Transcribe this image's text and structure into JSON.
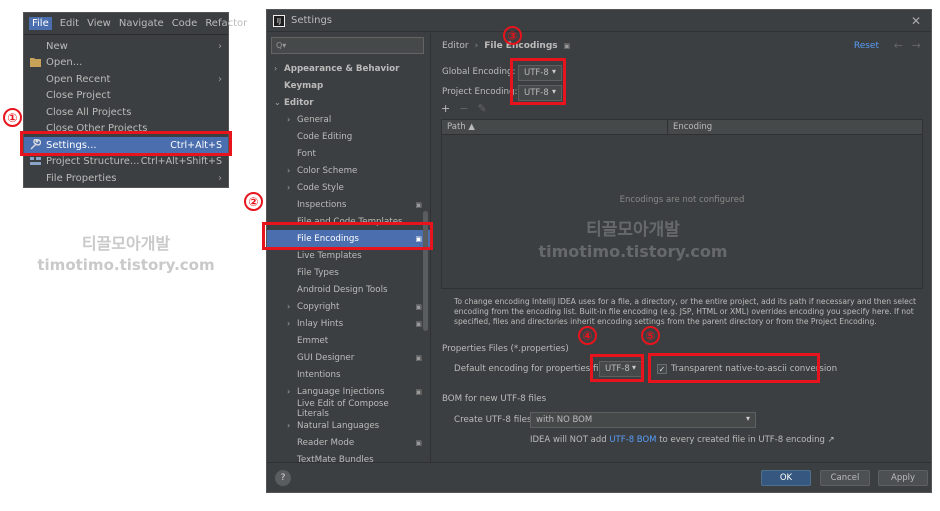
{
  "file_menu": {
    "menubar": [
      "File",
      "Edit",
      "View",
      "Navigate",
      "Code",
      "Refactor"
    ],
    "items": [
      {
        "label": "New",
        "shortcut": "",
        "arrow": "›",
        "icon": ""
      },
      {
        "label": "Open...",
        "shortcut": "",
        "arrow": "",
        "icon": "folder-icon"
      },
      {
        "label": "Open Recent",
        "shortcut": "",
        "arrow": "›",
        "icon": ""
      },
      {
        "label": "Close Project",
        "shortcut": "",
        "arrow": "",
        "icon": ""
      },
      {
        "label": "Close All Projects",
        "shortcut": "",
        "arrow": "",
        "icon": ""
      },
      {
        "label": "Close Other Projects",
        "shortcut": "",
        "arrow": "",
        "icon": ""
      },
      {
        "label": "Settings...",
        "shortcut": "Ctrl+Alt+S",
        "arrow": "",
        "icon": "wrench-icon"
      },
      {
        "label": "Project Structure...",
        "shortcut": "Ctrl+Alt+Shift+S",
        "arrow": "",
        "icon": "structure-icon"
      },
      {
        "label": "File Properties",
        "shortcut": "",
        "arrow": "›",
        "icon": ""
      }
    ]
  },
  "annotations": {
    "n1": "①",
    "n2": "②",
    "n3": "③",
    "n4": "④",
    "n5": "⑤"
  },
  "watermark": {
    "line1": "티끌모아개발",
    "line2": "timotimo.tistory.com"
  },
  "settings": {
    "title": "Settings",
    "close": "✕",
    "search_placeholder": "Q▾",
    "tree": [
      {
        "label": "Appearance & Behavior",
        "arrow": "›",
        "bold": true,
        "badge": "",
        "indent": 0
      },
      {
        "label": "Keymap",
        "arrow": "",
        "bold": true,
        "badge": "",
        "indent": 0
      },
      {
        "label": "Editor",
        "arrow": "⌄",
        "bold": true,
        "badge": "",
        "indent": 0
      },
      {
        "label": "General",
        "arrow": "›",
        "bold": false,
        "badge": "",
        "indent": 1
      },
      {
        "label": "Code Editing",
        "arrow": "",
        "bold": false,
        "badge": "",
        "indent": 1
      },
      {
        "label": "Font",
        "arrow": "",
        "bold": false,
        "badge": "",
        "indent": 1
      },
      {
        "label": "Color Scheme",
        "arrow": "›",
        "bold": false,
        "badge": "",
        "indent": 1
      },
      {
        "label": "Code Style",
        "arrow": "›",
        "bold": false,
        "badge": "",
        "indent": 1
      },
      {
        "label": "Inspections",
        "arrow": "",
        "bold": false,
        "badge": "▣",
        "indent": 1
      },
      {
        "label": "File and Code Templates",
        "arrow": "",
        "bold": false,
        "badge": "",
        "indent": 1
      },
      {
        "label": "File Encodings",
        "arrow": "",
        "bold": false,
        "badge": "▣",
        "indent": 1,
        "selected": true
      },
      {
        "label": "Live Templates",
        "arrow": "",
        "bold": false,
        "badge": "",
        "indent": 1
      },
      {
        "label": "File Types",
        "arrow": "",
        "bold": false,
        "badge": "",
        "indent": 1
      },
      {
        "label": "Android Design Tools",
        "arrow": "",
        "bold": false,
        "badge": "",
        "indent": 1
      },
      {
        "label": "Copyright",
        "arrow": "›",
        "bold": false,
        "badge": "▣",
        "indent": 1
      },
      {
        "label": "Inlay Hints",
        "arrow": "›",
        "bold": false,
        "badge": "▣",
        "indent": 1
      },
      {
        "label": "Emmet",
        "arrow": "",
        "bold": false,
        "badge": "",
        "indent": 1
      },
      {
        "label": "GUI Designer",
        "arrow": "",
        "bold": false,
        "badge": "▣",
        "indent": 1
      },
      {
        "label": "Intentions",
        "arrow": "",
        "bold": false,
        "badge": "",
        "indent": 1
      },
      {
        "label": "Language Injections",
        "arrow": "›",
        "bold": false,
        "badge": "▣",
        "indent": 1
      },
      {
        "label": "Live Edit of Compose Literals",
        "arrow": "",
        "bold": false,
        "badge": "",
        "indent": 1
      },
      {
        "label": "Natural Languages",
        "arrow": "›",
        "bold": false,
        "badge": "",
        "indent": 1
      },
      {
        "label": "Reader Mode",
        "arrow": "",
        "bold": false,
        "badge": "▣",
        "indent": 1
      },
      {
        "label": "TextMate Bundles",
        "arrow": "",
        "bold": false,
        "badge": "",
        "indent": 1
      }
    ],
    "breadcrumb": {
      "part1": "Editor",
      "sep": "›",
      "part2": "File Encodings",
      "pin": "▣"
    },
    "reset": "Reset",
    "back": "←",
    "forward": "→",
    "global_label": "Global Encoding:",
    "global_value": "UTF-8",
    "project_label": "Project Encoding:",
    "project_value": "UTF-8",
    "tool_add": "+",
    "tool_remove": "−",
    "tool_edit": "✎",
    "col_path": "Path ▲",
    "col_encoding": "Encoding",
    "empty_text": "Encodings are not configured",
    "description": "To change encoding IntelliJ IDEA uses for a file, a directory, or the entire project, add its path if necessary and then select encoding from the encoding list. Built-in file encoding (e.g. JSP, HTML or XML) overrides encoding you specify here. If not specified, files and directories inherit encoding settings from the parent directory or from the Project Encoding.",
    "properties_section": "Properties Files (*.properties)",
    "default_props_label": "Default encoding for properties files:",
    "default_props_value": "UTF-8",
    "transparent_label": "Transparent native-to-ascii conversion",
    "transparent_checked": "✓",
    "bom_section": "BOM for new UTF-8 files",
    "create_label": "Create UTF-8 files:",
    "create_value": "with NO BOM",
    "note_pre": "IDEA will NOT add ",
    "note_link": "UTF-8 BOM",
    "note_post": " to every created file in UTF-8 encoding ↗",
    "help": "?",
    "ok": "OK",
    "cancel": "Cancel",
    "apply": "Apply"
  },
  "colors": {
    "annotation_red": "#e8141d",
    "selection_blue": "#4b6eaf",
    "dark_bg": "#3c3f41",
    "link_blue": "#589df6"
  }
}
